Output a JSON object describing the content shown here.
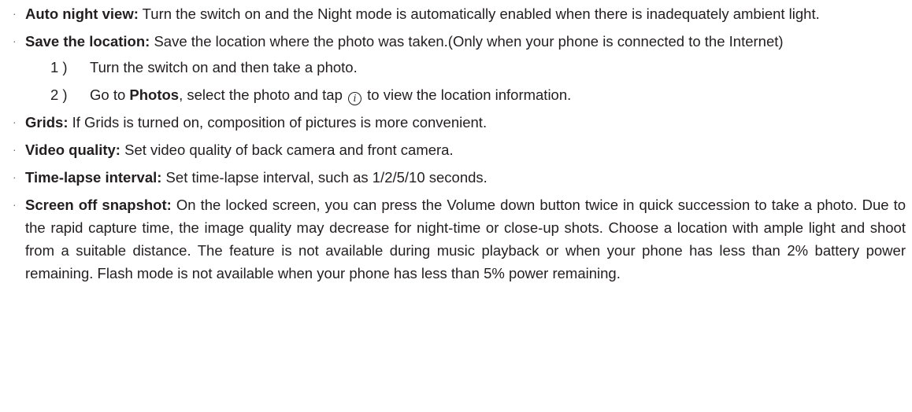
{
  "bullet_glyph": "·",
  "items": [
    {
      "term": "Auto night view:",
      "text": " Turn the switch on and the Night mode is automatically enabled when there is inadequately ambient light."
    },
    {
      "term": "Save the location:",
      "text": " Save the location where the photo was taken.(Only when your phone is connected to the Internet)",
      "steps": [
        {
          "num": "1 )",
          "text": "Turn the switch on and then take a photo."
        },
        {
          "num": "2 )",
          "pre": "Go to ",
          "bold": "Photos",
          "mid": ", select the photo and tap ",
          "icon_name": "info-icon",
          "icon_glyph": "i",
          "post": " to view the location information."
        }
      ]
    },
    {
      "term": "Grids:",
      "text": " If Grids is turned on, composition of pictures is more convenient."
    },
    {
      "term": "Video quality:",
      "text": " Set video quality of back camera and front camera."
    },
    {
      "term": "Time-lapse interval:",
      "text": " Set time-lapse interval, such as 1/2/5/10 seconds."
    },
    {
      "term": "Screen off snapshot:",
      "text": " On the locked screen, you can press the Volume down button twice in quick succession  to take a photo. Due to the rapid capture time, the image quality may decrease for night-time or close-up shots. Choose a location with ample light and shoot from a suitable distance. The feature is not available during music playback or when your phone has less than 2% battery power remaining. Flash mode is not available when your phone has less than 5% power remaining."
    }
  ]
}
